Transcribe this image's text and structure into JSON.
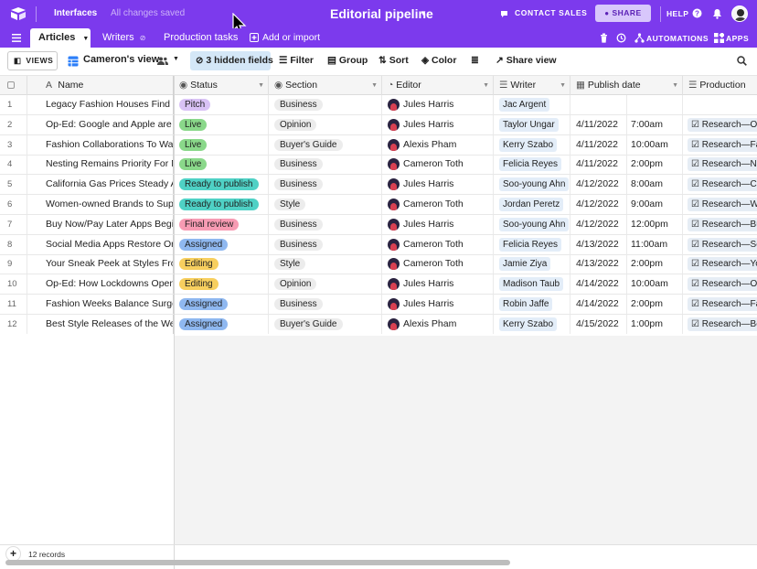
{
  "topbar": {
    "interfaces": "Interfaces",
    "saved_status": "All changes saved",
    "title": "Editorial pipeline",
    "contact_sales": "CONTACT SALES",
    "share": "SHARE",
    "help": "HELP"
  },
  "tabs": [
    {
      "label": "Articles",
      "active": true
    },
    {
      "label": "Writers"
    },
    {
      "label": "Production tasks"
    }
  ],
  "tabsbar": {
    "add_or_import": "Add or import",
    "automations": "AUTOMATIONS",
    "apps": "APPS"
  },
  "toolbar": {
    "views": "VIEWS",
    "view_name": "Cameron's view",
    "hidden_fields": "3 hidden fields",
    "filter": "Filter",
    "group": "Group",
    "sort": "Sort",
    "color": "Color",
    "share_view": "Share view"
  },
  "columns": {
    "name": "Name",
    "status": "Status",
    "section": "Section",
    "editor": "Editor",
    "writer": "Writer",
    "publish_date": "Publish date",
    "production_tasks": "Production tasks"
  },
  "status_colors": {
    "Pitch": "#d9c2f5",
    "Live": "#8ad88a",
    "Ready to publish": "#4fd1c5",
    "Final review": "#f79bb3",
    "Assigned": "#8fb8f0",
    "Editing": "#f7cf5f"
  },
  "rows": [
    {
      "num": "1",
      "name": "Legacy Fashion Houses Find N...",
      "status": "Pitch",
      "section": "Business",
      "editor": "Jules Harris",
      "writer": "Jac Argent",
      "date": "",
      "time": "",
      "task": ""
    },
    {
      "num": "2",
      "name": "Op-Ed: Google and Apple are S...",
      "status": "Live",
      "section": "Opinion",
      "editor": "Jules Harris",
      "writer": "Taylor Ungar",
      "date": "4/11/2022",
      "time": "7:00am",
      "task": "Research—Op-E"
    },
    {
      "num": "3",
      "name": "Fashion Collaborations To Wat...",
      "status": "Live",
      "section": "Buyer's Guide",
      "editor": "Alexis Pham",
      "writer": "Kerry Szabo",
      "date": "4/11/2022",
      "time": "10:00am",
      "task": "Research—Fash"
    },
    {
      "num": "4",
      "name": "Nesting Remains Priority For M...",
      "status": "Live",
      "section": "Business",
      "editor": "Cameron Toth",
      "writer": "Felicia Reyes",
      "date": "4/11/2022",
      "time": "2:00pm",
      "task": "Research—Nest"
    },
    {
      "num": "5",
      "name": "California Gas Prices Steady A...",
      "status": "Ready to publish",
      "section": "Business",
      "editor": "Jules Harris",
      "writer": "Soo-young Ahn",
      "date": "4/12/2022",
      "time": "8:00am",
      "task": "Research—Calif"
    },
    {
      "num": "6",
      "name": "Women-owned Brands to Supp...",
      "status": "Ready to publish",
      "section": "Style",
      "editor": "Cameron Toth",
      "writer": "Jordan Peretz",
      "date": "4/12/2022",
      "time": "9:00am",
      "task": "Research—Won"
    },
    {
      "num": "7",
      "name": "Buy Now/Pay Later Apps Begin...",
      "status": "Final review",
      "section": "Business",
      "editor": "Jules Harris",
      "writer": "Soo-young Ahn",
      "date": "4/12/2022",
      "time": "12:00pm",
      "task": "Research—Buy"
    },
    {
      "num": "8",
      "name": "Social Media Apps Restore Ori...",
      "status": "Assigned",
      "section": "Business",
      "editor": "Cameron Toth",
      "writer": "Felicia Reyes",
      "date": "4/13/2022",
      "time": "11:00am",
      "task": "Research—Soci"
    },
    {
      "num": "9",
      "name": "Your Sneak Peek at Styles Fro...",
      "status": "Editing",
      "section": "Style",
      "editor": "Cameron Toth",
      "writer": "Jamie Ziya",
      "date": "4/13/2022",
      "time": "2:00pm",
      "task": "Research—Your"
    },
    {
      "num": "10",
      "name": "Op-Ed: How Lockdowns Opene...",
      "status": "Editing",
      "section": "Opinion",
      "editor": "Jules Harris",
      "writer": "Madison Taub",
      "date": "4/14/2022",
      "time": "10:00am",
      "task": "Research—Op-E"
    },
    {
      "num": "11",
      "name": "Fashion Weeks Balance Surge i...",
      "status": "Assigned",
      "section": "Business",
      "editor": "Jules Harris",
      "writer": "Robin Jaffe",
      "date": "4/14/2022",
      "time": "2:00pm",
      "task": "Research—Fash"
    },
    {
      "num": "12",
      "name": "Best Style Releases of the Week",
      "status": "Assigned",
      "section": "Buyer's Guide",
      "editor": "Alexis Pham",
      "writer": "Kerry Szabo",
      "date": "4/15/2022",
      "time": "1:00pm",
      "task": "Research—Best"
    }
  ],
  "footer": {
    "records": "12 records"
  }
}
